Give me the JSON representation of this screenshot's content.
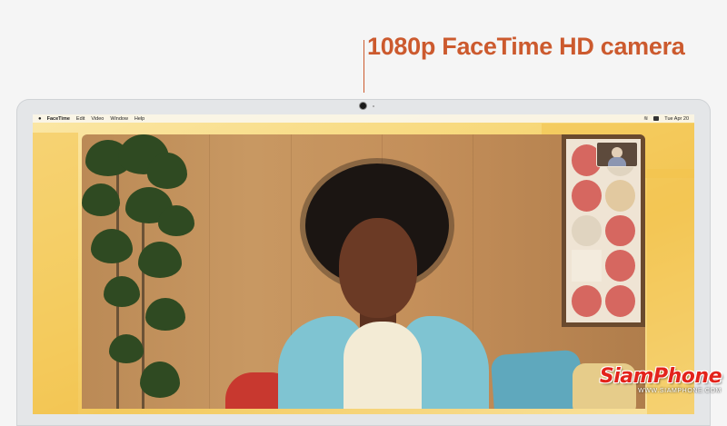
{
  "headline": "1080p FaceTime HD camera",
  "menubar": {
    "app_name": "FaceTime",
    "items": [
      "Edit",
      "Video",
      "Window",
      "Help"
    ],
    "datetime": "Tue Apr 20"
  },
  "watermark": {
    "brand": "SiamPhone",
    "url": "WWW.SIAMPHONE.COM"
  },
  "colors": {
    "headline": "#cc5a2e",
    "brand": "#e3231b",
    "wallpaper": "#f7d87a"
  },
  "icons": [
    "apple-icon",
    "wifi-icon",
    "control-center-icon",
    "camera-icon"
  ]
}
